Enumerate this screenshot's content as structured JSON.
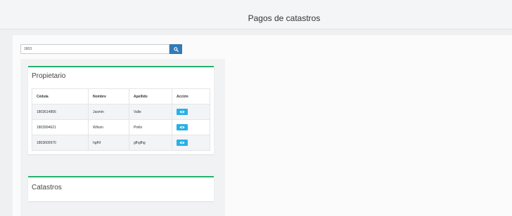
{
  "header": {
    "title": "Pagos de catastros"
  },
  "search": {
    "value": "1803"
  },
  "propietario": {
    "title": "Propietario",
    "columns": [
      "Cédula",
      "Nombre",
      "Apellido",
      "Acción"
    ],
    "rows": [
      {
        "cedula": "1803614856",
        "nombre": "Jasmin",
        "apellido": "Valle"
      },
      {
        "cedula": "1803994621",
        "nombre": "Wilson",
        "apellido": "Pinllo"
      },
      {
        "cedula": "1803600970",
        "nombre": "hgfhf",
        "apellido": "gfhgfhg"
      }
    ]
  },
  "catastros": {
    "title": "Catastros"
  },
  "colors": {
    "accent": "#26b06e",
    "search_button": "#337ab7",
    "view_button": "#2bb0e3"
  },
  "icons": {
    "search": "search-icon",
    "view": "eye-icon"
  }
}
